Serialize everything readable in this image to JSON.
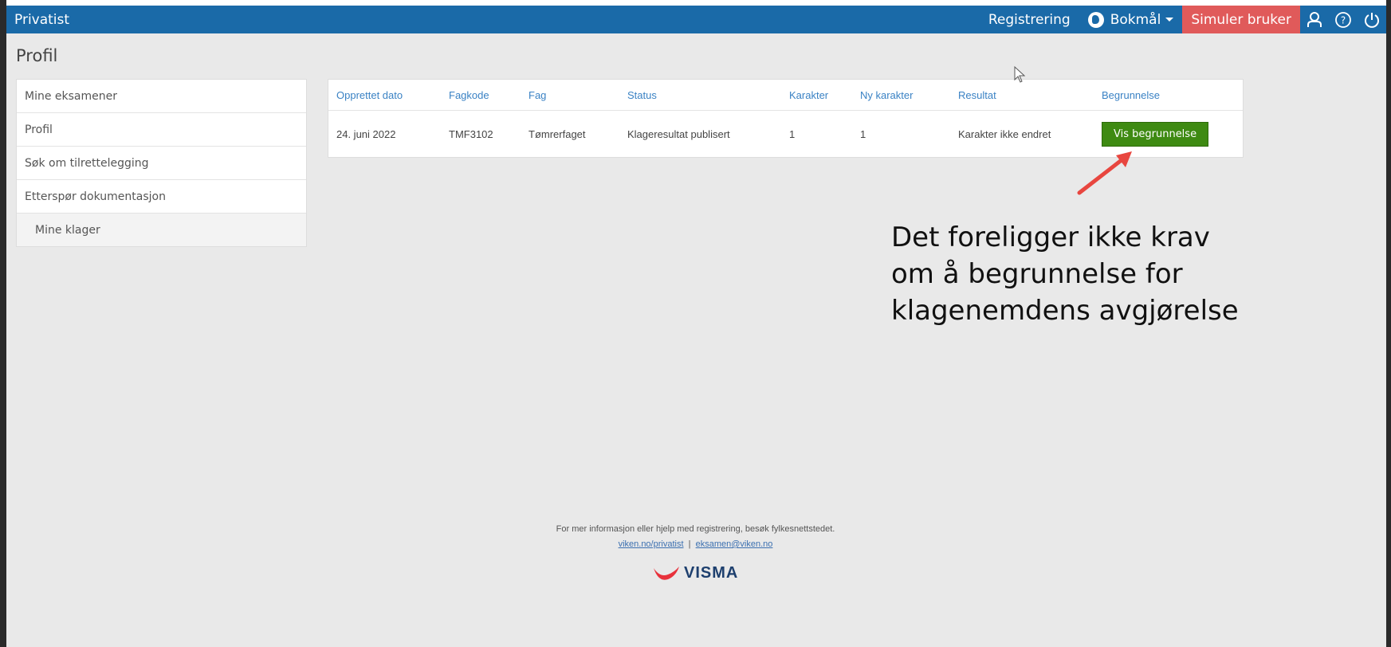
{
  "navbar": {
    "brand": "Privatist",
    "registrering": "Registrering",
    "language": "Bokmål",
    "simuler": "Simuler bruker",
    "icons": [
      "user-icon",
      "help-icon",
      "power-icon"
    ]
  },
  "page_title": "Profil",
  "sidebar": {
    "items": [
      {
        "label": "Mine eksamener"
      },
      {
        "label": "Profil"
      },
      {
        "label": "Søk om tilrettelegging"
      },
      {
        "label": "Etterspør dokumentasjon"
      },
      {
        "label": "Mine klager"
      }
    ]
  },
  "table": {
    "headers": [
      "Opprettet dato",
      "Fagkode",
      "Fag",
      "Status",
      "Karakter",
      "Ny karakter",
      "Resultat",
      "Begrunnelse"
    ],
    "rows": [
      {
        "dato": "24. juni 2022",
        "fagkode": "TMF3102",
        "fag": "Tømrerfaget",
        "status": "Klageresultat publisert",
        "karakter": "1",
        "ny_karakter": "1",
        "resultat": "Karakter ikke endret",
        "button": "Vis begrunnelse"
      }
    ]
  },
  "annotation": {
    "line1": "Det foreligger ikke krav",
    "line2": "om å begrunnelse for",
    "line3": "klagenemdens avgjørelse",
    "arrow_color": "#e8463f"
  },
  "footer": {
    "text": "For mer informasjon eller hjelp med registrering, besøk fylkesnettstedet.",
    "link1": "viken.no/privatist",
    "separator": "|",
    "link2": "eksamen@viken.no",
    "logo": "VISMA"
  },
  "colors": {
    "navbar": "#1a6aa8",
    "simuler": "#e05a5a",
    "button": "#3e8a12",
    "header_text": "#3a82c4"
  }
}
